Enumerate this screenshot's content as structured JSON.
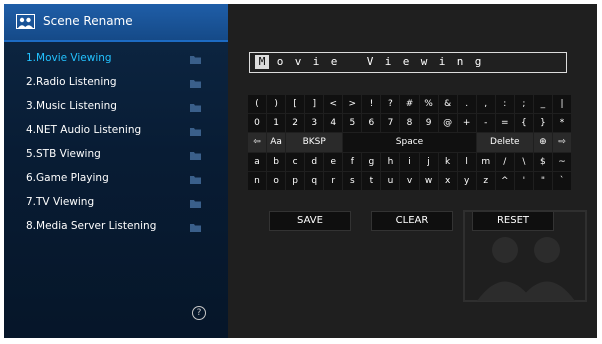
{
  "header": {
    "title": "Scene Rename"
  },
  "scenes": [
    {
      "label": "1.Movie Viewing",
      "active": true
    },
    {
      "label": "2.Radio Listening",
      "active": false
    },
    {
      "label": "3.Music Listening",
      "active": false
    },
    {
      "label": "4.NET Audio Listening",
      "active": false
    },
    {
      "label": "5.STB Viewing",
      "active": false
    },
    {
      "label": "6.Game Playing",
      "active": false
    },
    {
      "label": "7.TV Viewing",
      "active": false
    },
    {
      "label": "8.Media Server Listening",
      "active": false
    }
  ],
  "help": {
    "symbol": "?"
  },
  "name_field": {
    "chars": [
      "M",
      "o",
      "v",
      "i",
      "e",
      "",
      "V",
      "i",
      "e",
      "w",
      "i",
      "n",
      "g"
    ]
  },
  "keyboard": {
    "row1": [
      "(",
      ")",
      "[",
      "]",
      "<",
      ">",
      "!",
      "?",
      "#",
      "%",
      "&",
      ".",
      ",",
      ":",
      ";",
      "_",
      "|"
    ],
    "row2": [
      "0",
      "1",
      "2",
      "3",
      "4",
      "5",
      "6",
      "7",
      "8",
      "9",
      "@",
      "+",
      "-",
      "=",
      "{",
      "}",
      "*"
    ],
    "row3_keys": {
      "left_arrow": "⇦",
      "case": "Aa",
      "bksp": "BKSP",
      "space": "Space",
      "delete": "Delete",
      "globe": "⊕",
      "right_arrow": "⇨"
    },
    "row4": [
      "a",
      "b",
      "c",
      "d",
      "e",
      "f",
      "g",
      "h",
      "i",
      "j",
      "k",
      "l",
      "m",
      "/",
      "\\",
      "$",
      "~"
    ],
    "row5": [
      "n",
      "o",
      "p",
      "q",
      "r",
      "s",
      "t",
      "u",
      "v",
      "w",
      "x",
      "y",
      "z",
      "^",
      "'",
      "\"",
      "`"
    ]
  },
  "buttons": {
    "save": "SAVE",
    "clear": "CLEAR",
    "reset": "RESET"
  },
  "colors": {
    "active": "#23c2ff",
    "sidebar": "#0b2240",
    "header": "#1f5ea8",
    "panel": "#1f1f1f"
  }
}
